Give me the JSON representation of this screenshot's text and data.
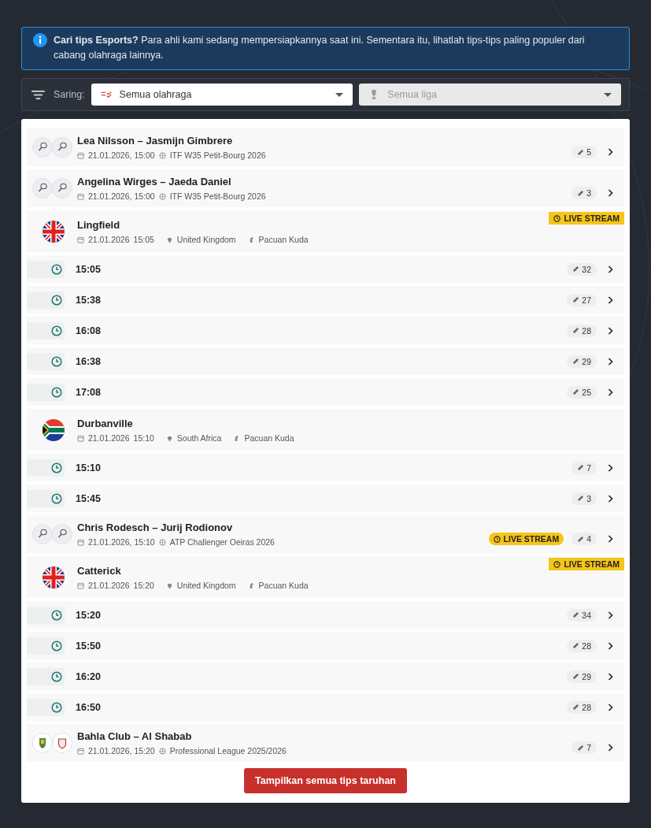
{
  "notice": {
    "lead": "Cari tips Esports?",
    "text": "Para ahli kami sedang mempersiapkannya saat ini. Sementara itu, lihatlah tips-tips paling populer dari cabang olahraga lainnya."
  },
  "filter": {
    "label": "Saring:",
    "sport": {
      "value": "Semua olahraga"
    },
    "league": {
      "placeholder": "Semua liga",
      "disabled": true
    }
  },
  "items": [
    {
      "kind": "tennis_match",
      "title": "Lea Nilsson – Jasmijn Gimbrere",
      "date": "21.01.2026, 15:00",
      "league": "ITF W35 Petit-Bourg 2026",
      "tips": "5",
      "live_stream": false
    },
    {
      "kind": "tennis_match",
      "title": "Angelina Wirges – Jaeda Daniel",
      "date": "21.01.2026, 15:00",
      "league": "ITF W35 Petit-Bourg 2026",
      "tips": "3",
      "live_stream": false
    },
    {
      "kind": "uk_meeting",
      "title": "Lingfield",
      "date": "21.01.2026",
      "time": "15:05",
      "country": "United Kingdom",
      "sport": "Pacuan Kuda",
      "live_stream": true,
      "live_label": "LIVE STREAM",
      "races": [
        {
          "time": "15:05",
          "tips": "32"
        },
        {
          "time": "15:38",
          "tips": "27"
        },
        {
          "time": "16:08",
          "tips": "28"
        },
        {
          "time": "16:38",
          "tips": "29"
        },
        {
          "time": "17:08",
          "tips": "25"
        }
      ]
    },
    {
      "kind": "za_meeting",
      "title": "Durbanville",
      "date": "21.01.2026",
      "time": "15:10",
      "country": "South Africa",
      "sport": "Pacuan Kuda",
      "live_stream": false,
      "races": [
        {
          "time": "15:10",
          "tips": "7"
        },
        {
          "time": "15:45",
          "tips": "3"
        }
      ]
    },
    {
      "kind": "tennis_match",
      "title": "Chris Rodesch – Jurij Rodionov",
      "date": "21.01.2026, 15:10",
      "league": "ATP Challenger Oeiras 2026",
      "tips": "4",
      "live_stream": true,
      "live_label": "LIVE STREAM"
    },
    {
      "kind": "uk_meeting",
      "title": "Catterick",
      "date": "21.01.2026",
      "time": "15:20",
      "country": "United Kingdom",
      "sport": "Pacuan Kuda",
      "live_stream": true,
      "live_label": "LIVE STREAM",
      "races": [
        {
          "time": "15:20",
          "tips": "34"
        },
        {
          "time": "15:50",
          "tips": "28"
        },
        {
          "time": "16:20",
          "tips": "29"
        },
        {
          "time": "16:50",
          "tips": "28"
        }
      ]
    },
    {
      "kind": "football_match",
      "title": "Bahla Club – Al Shabab",
      "date": "21.01.2026, 15:20",
      "league": "Professional League 2025/2026",
      "tips": "7",
      "live_stream": false
    }
  ],
  "show_all_button": "Tampilkan semua tips taruhan"
}
